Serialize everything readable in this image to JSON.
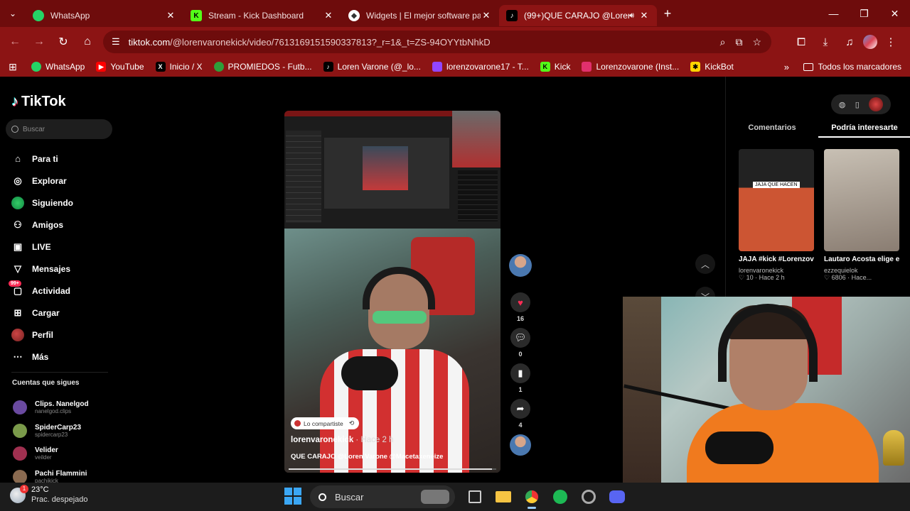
{
  "browser": {
    "tabs": [
      {
        "title": "WhatsApp",
        "icon": "whatsapp-icon",
        "color": "#25d366"
      },
      {
        "title": "Stream - Kick Dashboard",
        "icon": "kick-icon",
        "color": "#53fc18"
      },
      {
        "title": "Widgets | El mejor software par",
        "icon": "streamelements-icon",
        "color": "#ffffff"
      },
      {
        "title": "(99+)QUE CARAJO @Loren",
        "icon": "tiktok-icon",
        "color": "#000000",
        "active": true
      }
    ],
    "url_host": "tiktok.com",
    "url_path": "/@lorenvaronekick/video/7613169151590337813?_r=1&_t=ZS-94OYYtbNhkD",
    "bookmarks": [
      {
        "label": "WhatsApp",
        "icon": "whatsapp-icon",
        "color": "#25d366"
      },
      {
        "label": "YouTube",
        "icon": "youtube-icon",
        "color": "#ff0000"
      },
      {
        "label": "Inicio / X",
        "icon": "x-icon",
        "color": "#000000"
      },
      {
        "label": "PROMIEDOS - Futb...",
        "icon": "promiedos-icon",
        "color": "#2e9e3a"
      },
      {
        "label": "Loren Varone (@_lo...",
        "icon": "tiktok-icon",
        "color": "#000000"
      },
      {
        "label": "lorenzovarone17 - T...",
        "icon": "twitch-icon",
        "color": "#9146ff"
      },
      {
        "label": "Kick",
        "icon": "kick-icon",
        "color": "#53fc18"
      },
      {
        "label": "Lorenzovarone (Inst...",
        "icon": "instagram-icon",
        "color": "#e1306c"
      },
      {
        "label": "KickBot",
        "icon": "kickbot-icon",
        "color": "#ffd400"
      }
    ],
    "all_bookmarks": "Todos los marcadores",
    "theme_color": "#8c1414"
  },
  "tiktok": {
    "logo": "TikTok",
    "search_placeholder": "Buscar",
    "nav": [
      {
        "label": "Para ti",
        "icon": "home-icon"
      },
      {
        "label": "Explorar",
        "icon": "compass-icon"
      },
      {
        "label": "Siguiendo",
        "icon": "following-avatar-icon"
      },
      {
        "label": "Amigos",
        "icon": "friends-icon"
      },
      {
        "label": "LIVE",
        "icon": "live-icon"
      },
      {
        "label": "Mensajes",
        "icon": "messages-icon"
      },
      {
        "label": "Actividad",
        "icon": "activity-icon",
        "badge": "99+"
      },
      {
        "label": "Cargar",
        "icon": "upload-icon"
      },
      {
        "label": "Perfil",
        "icon": "profile-avatar-icon"
      },
      {
        "label": "Más",
        "icon": "more-icon"
      }
    ],
    "following_title": "Cuentas que sigues",
    "following": [
      {
        "name": "Clips. Nanelgod",
        "user": "nanelgod.clips",
        "color": "#6a4aa0"
      },
      {
        "name": "SpiderCarp23",
        "user": "spidercarp23",
        "color": "#7a9a4a"
      },
      {
        "name": "Velider",
        "user": "veilder",
        "color": "#a03050"
      },
      {
        "name": "Pachi Flammini",
        "user": "pachikick",
        "color": "#8a6a50"
      }
    ],
    "video": {
      "share_label": "Lo compartiste",
      "author": "lorenvaronekick",
      "ago": "· Hace 2 h",
      "caption": "QUE CARAJO @Loren Varone @Macetaxeneize",
      "progress": 0.98,
      "likes": "16",
      "comments": "0",
      "saves": "1",
      "shares": "4"
    },
    "right_panel": {
      "tabs": [
        "Comentarios",
        "Podría interesarte"
      ],
      "active_tab": 1,
      "recommendations": [
        {
          "title": "JAJA #kick #Lorenzovarone...",
          "user": "lorenvaronekick",
          "stats": "♡ 10 · Hace 2 h",
          "thumb_label": "JAJA QUE HACEN"
        },
        {
          "title": "Lautaro Acosta elige entre los...",
          "user": "ezzequielok",
          "stats": "♡ 6806 · Hace..."
        }
      ]
    }
  },
  "taskbar": {
    "temp": "23°C",
    "condition": "Prac. despejado",
    "weather_badge": "1",
    "search": "Buscar"
  }
}
